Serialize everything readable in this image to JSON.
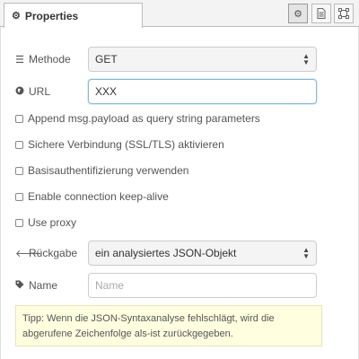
{
  "tabs": {
    "properties": "Properties"
  },
  "toolbar": {
    "settings_icon": "gear-icon",
    "description_icon": "document-icon",
    "appearance_icon": "frame-icon"
  },
  "form": {
    "method": {
      "label": "Methode",
      "value": "GET"
    },
    "url": {
      "label": "URL",
      "value": "XXX"
    },
    "checkboxes": [
      "Append msg.payload as query string parameters",
      "Sichere Verbindung (SSL/TLS) aktivieren",
      "Basisauthentifizierung verwenden",
      "Enable connection keep-alive",
      "Use proxy"
    ],
    "return": {
      "label": "Rückgabe",
      "value": "ein analysiertes JSON-Objekt"
    },
    "name": {
      "label": "Name",
      "placeholder": "Name"
    }
  },
  "tip": "Tipp: Wenn die JSON-Syntaxanalyse fehlschlägt, wird die abgerufene Zeichenfolge als-ist zurückgegeben."
}
